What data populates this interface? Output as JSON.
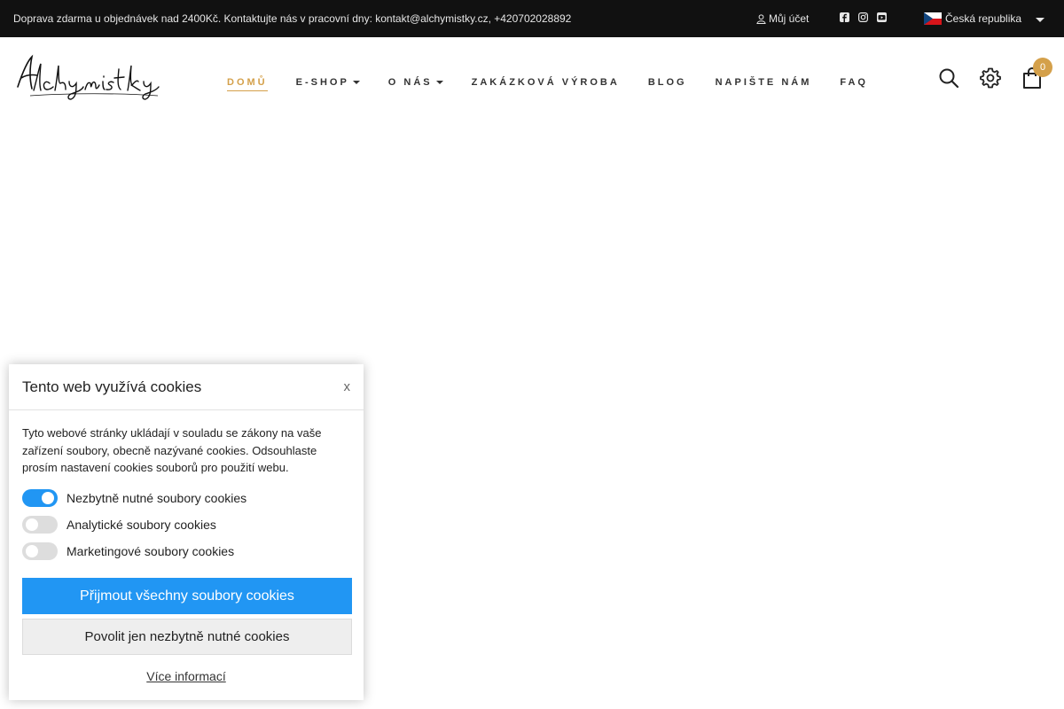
{
  "topbar": {
    "notice": "Doprava zdarma u objednávek nad 2400Kč. Kontaktujte nás v pracovní dny: kontakt@alchymistky.cz, +420702028892",
    "account_label": "Můj účet",
    "socials": [
      "facebook-icon",
      "instagram-icon",
      "youtube-icon"
    ],
    "language": "Česká republika"
  },
  "header": {
    "logo_text": "Alchymistky",
    "nav": [
      {
        "label": "DOMŮ",
        "active": true
      },
      {
        "label": "E-SHOP",
        "dropdown": true
      },
      {
        "label": "O NÁS",
        "dropdown": true
      },
      {
        "label": "ZAKÁZKOVÁ VÝROBA"
      },
      {
        "label": "BLOG"
      },
      {
        "label": "NAPIŠTE NÁM"
      },
      {
        "label": "FAQ"
      }
    ],
    "icons": [
      "search-icon",
      "settings-icon",
      "cart-icon"
    ],
    "cart_count": "0"
  },
  "cookie": {
    "title": "Tento web využívá cookies",
    "close": "x",
    "text": "Tyto webové stránky ukládají v souladu se zákony na vaše zařízení soubory, obecně nazývané cookies. Odsouhlaste prosím nastavení cookies souborů pro použití webu.",
    "toggles": [
      {
        "label": "Nezbytně nutné soubory cookies",
        "on": true
      },
      {
        "label": "Analytické soubory cookies",
        "on": false
      },
      {
        "label": "Marketingové soubory cookies",
        "on": false
      }
    ],
    "accept_all": "Přijmout všechny soubory cookies",
    "necessary_only": "Povolit jen nezbytně nutné cookies",
    "more_info": "Více informací"
  },
  "colors": {
    "accent": "#d4a04a",
    "primary_button": "#2196f3",
    "topbar": "#111111"
  }
}
